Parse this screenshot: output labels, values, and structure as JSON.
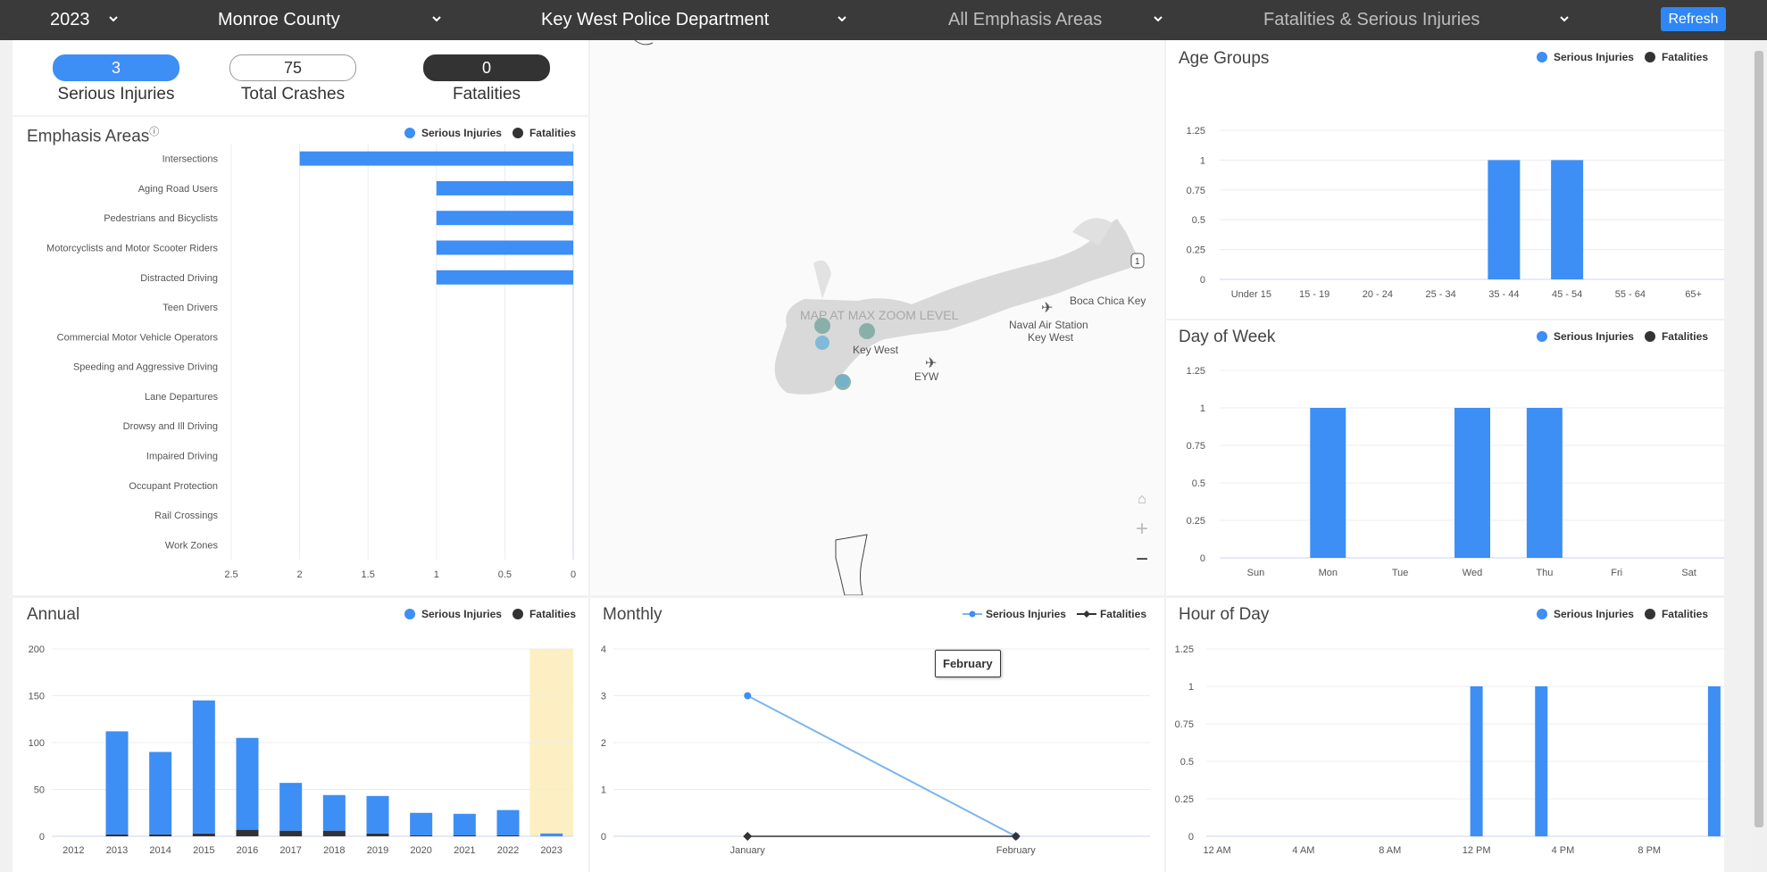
{
  "topbar": {
    "year": "2023",
    "county": "Monroe County",
    "agency": "Key West Police Department",
    "emphasis_filter": "All Emphasis Areas",
    "severity_filter": "Fatalities & Serious Injuries",
    "refresh_label": "Refresh"
  },
  "summary": {
    "serious_injuries": {
      "value": "3",
      "label": "Serious Injuries"
    },
    "total_crashes": {
      "value": "75",
      "label": "Total Crashes"
    },
    "fatalities": {
      "value": "0",
      "label": "Fatalities"
    }
  },
  "legend": {
    "serious": "Serious Injuries",
    "fatal": "Fatalities"
  },
  "colors": {
    "serious": "#3d8ef5",
    "fatal": "#333333",
    "monthly_serious": "#7cb5ec",
    "highlight": "#fcefc4"
  },
  "map": {
    "overlay": "MAP AT MAX ZOOM LEVEL",
    "labels": {
      "key_west": "Key West",
      "eyw": "EYW",
      "naval": "Naval Air Station",
      "naval2": "Key West",
      "boca": "Boca Chica Key",
      "route": "1"
    }
  },
  "emphasis": {
    "title": "Emphasis Areas",
    "chart_data": {
      "type": "bar",
      "orientation": "horizontal-reversed",
      "categories": [
        "Intersections",
        "Aging Road Users",
        "Pedestrians and Bicyclists",
        "Motorcyclists and Motor Scooter Riders",
        "Distracted Driving",
        "Teen Drivers",
        "Commercial Motor Vehicle Operators",
        "Speeding and Aggressive Driving",
        "Lane Departures",
        "Drowsy and Ill Driving",
        "Impaired Driving",
        "Occupant Protection",
        "Rail Crossings",
        "Work Zones"
      ],
      "series": [
        {
          "name": "Serious Injuries",
          "values": [
            2,
            1,
            1,
            1,
            1,
            0,
            0,
            0,
            0,
            0,
            0,
            0,
            0,
            0
          ]
        },
        {
          "name": "Fatalities",
          "values": [
            0,
            0,
            0,
            0,
            0,
            0,
            0,
            0,
            0,
            0,
            0,
            0,
            0,
            0
          ]
        }
      ],
      "ticks": [
        "2.5",
        "2",
        "1.5",
        "1",
        "0.5",
        "0"
      ],
      "xlim": [
        0,
        2.5
      ]
    }
  },
  "age": {
    "title": "Age Groups",
    "chart_data": {
      "type": "bar",
      "categories": [
        "Under 15",
        "15 - 19",
        "20 - 24",
        "25 - 34",
        "35 - 44",
        "45 - 54",
        "55 - 64",
        "65+"
      ],
      "series": [
        {
          "name": "Serious Injuries",
          "values": [
            0,
            0,
            0,
            0,
            1,
            1,
            0,
            0
          ]
        },
        {
          "name": "Fatalities",
          "values": [
            0,
            0,
            0,
            0,
            0,
            0,
            0,
            0
          ]
        }
      ],
      "ticks": [
        "0",
        "0.25",
        "0.5",
        "0.75",
        "1",
        "1.25"
      ],
      "ylim": [
        0,
        1.25
      ]
    }
  },
  "dow": {
    "title": "Day of Week",
    "chart_data": {
      "type": "bar",
      "categories": [
        "Sun",
        "Mon",
        "Tue",
        "Wed",
        "Thu",
        "Fri",
        "Sat"
      ],
      "series": [
        {
          "name": "Serious Injuries",
          "values": [
            0,
            1,
            0,
            1,
            1,
            0,
            0
          ]
        },
        {
          "name": "Fatalities",
          "values": [
            0,
            0,
            0,
            0,
            0,
            0,
            0
          ]
        }
      ],
      "ticks": [
        "0",
        "0.25",
        "0.5",
        "0.75",
        "1",
        "1.25"
      ],
      "ylim": [
        0,
        1.25
      ]
    }
  },
  "annual": {
    "title": "Annual",
    "chart_data": {
      "type": "bar",
      "stacked": true,
      "categories": [
        "2012",
        "2013",
        "2014",
        "2015",
        "2016",
        "2017",
        "2018",
        "2019",
        "2020",
        "2021",
        "2022",
        "2023"
      ],
      "series": [
        {
          "name": "Serious Injuries",
          "values": [
            0,
            110,
            88,
            142,
            98,
            51,
            38,
            40,
            24,
            23,
            27,
            3
          ]
        },
        {
          "name": "Fatalities",
          "values": [
            0,
            2,
            2,
            3,
            7,
            6,
            6,
            3,
            1,
            1,
            1,
            0
          ]
        }
      ],
      "highlight": "2023",
      "ticks": [
        "0",
        "50",
        "100",
        "150",
        "200"
      ],
      "ylim": [
        0,
        200
      ]
    }
  },
  "monthly": {
    "title": "Monthly",
    "tooltip": "February",
    "chart_data": {
      "type": "line",
      "categories": [
        "January",
        "February"
      ],
      "series": [
        {
          "name": "Serious Injuries",
          "values": [
            3,
            0
          ]
        },
        {
          "name": "Fatalities",
          "values": [
            0,
            0
          ]
        }
      ],
      "ticks": [
        "0",
        "1",
        "2",
        "3",
        "4"
      ],
      "ylim": [
        0,
        4
      ]
    }
  },
  "hour": {
    "title": "Hour of Day",
    "chart_data": {
      "type": "bar",
      "hours": 24,
      "tick_labels": [
        "12 AM",
        "4 AM",
        "8 AM",
        "12 PM",
        "4 PM",
        "8 PM"
      ],
      "series": [
        {
          "name": "Serious Injuries",
          "values": [
            0,
            0,
            0,
            0,
            0,
            0,
            0,
            0,
            0,
            0,
            0,
            0,
            1,
            0,
            0,
            1,
            0,
            0,
            0,
            0,
            0,
            0,
            0,
            1
          ]
        },
        {
          "name": "Fatalities",
          "values": [
            0,
            0,
            0,
            0,
            0,
            0,
            0,
            0,
            0,
            0,
            0,
            0,
            0,
            0,
            0,
            0,
            0,
            0,
            0,
            0,
            0,
            0,
            0,
            0
          ]
        }
      ],
      "ticks": [
        "0",
        "0.25",
        "0.5",
        "0.75",
        "1",
        "1.25"
      ],
      "ylim": [
        0,
        1.25
      ]
    }
  }
}
